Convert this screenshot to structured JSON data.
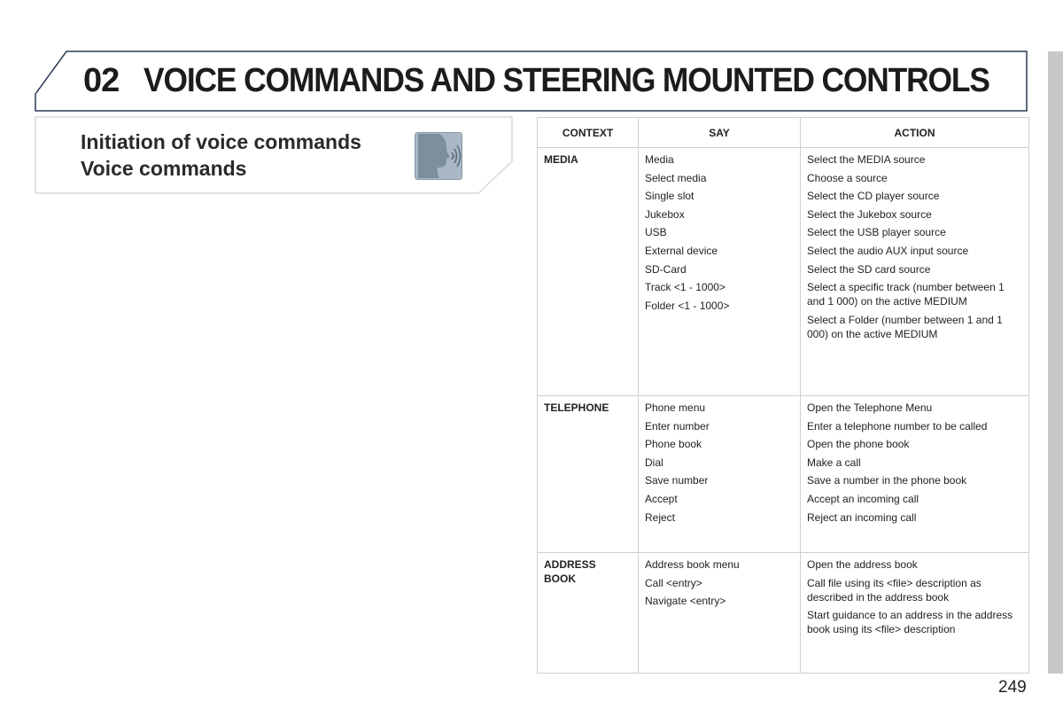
{
  "header": {
    "chapter_number": "02",
    "chapter_title": "VOICE COMMANDS AND STEERING MOUNTED CONTROLS"
  },
  "section": {
    "title_line1": "Initiation of voice commands",
    "title_line2": "Voice commands",
    "icon": "speaking-head-icon"
  },
  "table": {
    "columns": [
      "CONTEXT",
      "SAY",
      "ACTION"
    ],
    "rows": [
      {
        "context": [
          "MEDIA"
        ],
        "say": [
          "Media",
          "Select media",
          "Single slot",
          "Jukebox",
          "USB",
          "External device",
          "SD-Card",
          "Track <1 - 1000>",
          "Folder <1 - 1000>"
        ],
        "action": [
          "Select the MEDIA source",
          "Choose a source",
          "Select the CD player source",
          "Select the Jukebox source",
          "Select the USB player source",
          "Select the audio AUX input source",
          "Select the SD card source",
          "Select a specific track (number between 1 and 1 000) on the active MEDIUM",
          "Select a Folder (number between 1 and 1 000) on the active MEDIUM"
        ]
      },
      {
        "context": [
          "TELEPHONE"
        ],
        "say": [
          "Phone menu",
          "Enter number",
          "Phone book",
          "Dial",
          "Save number",
          "Accept",
          "Reject"
        ],
        "action": [
          "Open the Telephone Menu",
          "Enter a telephone number to be called",
          "Open the phone book",
          "Make a call",
          "Save a number in the phone book",
          "Accept an incoming call",
          "Reject an incoming call"
        ]
      },
      {
        "context": [
          "ADDRESS",
          "BOOK"
        ],
        "say": [
          "Address book menu",
          "Call <entry>",
          "Navigate <entry>"
        ],
        "action": [
          "Open the address book",
          "Call file using its <file> description as described in the address book",
          "Start guidance to an address in the address book using its <file> description"
        ]
      }
    ]
  },
  "footer": {
    "page_number": "249"
  },
  "colors": {
    "header_border": "#2b3a55",
    "sub_border": "#d0d0d0",
    "side_bar": "#c6c7c9",
    "icon_bg": "#8a9aa8"
  }
}
